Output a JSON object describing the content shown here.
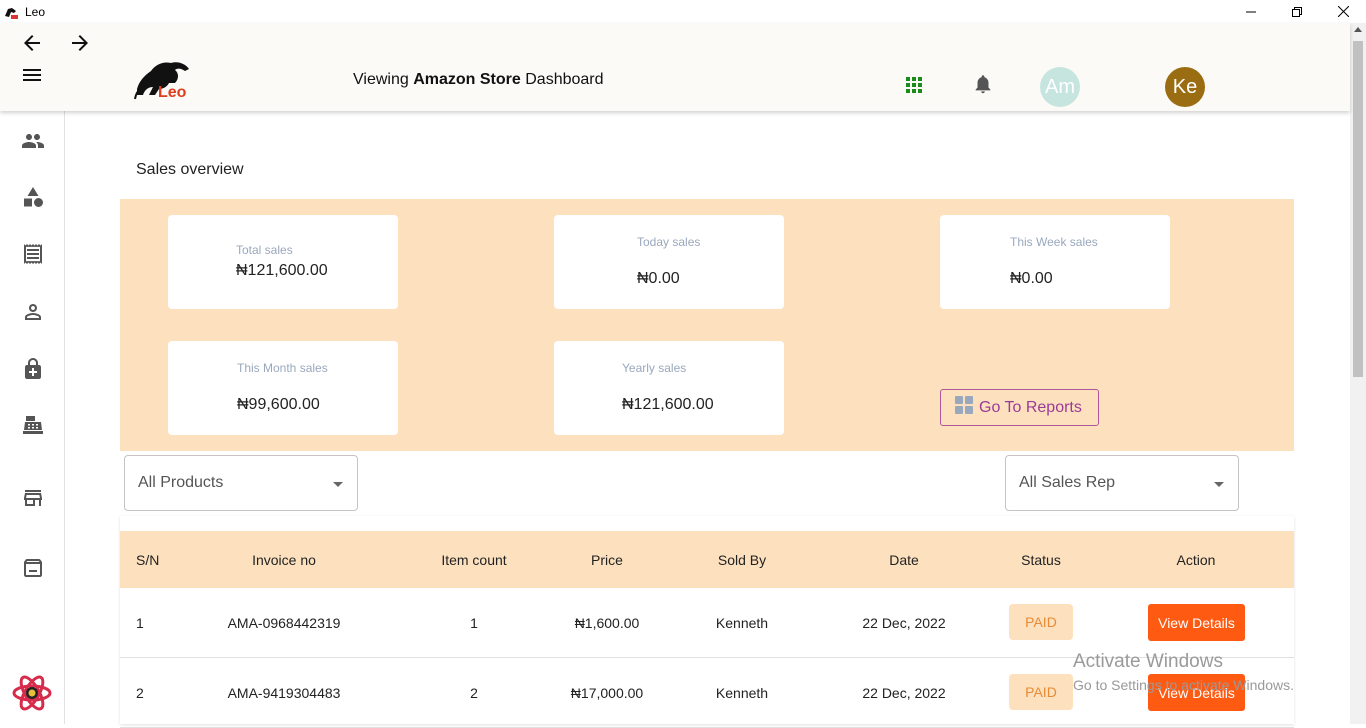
{
  "window": {
    "title": "Leo"
  },
  "header": {
    "viewing_prefix": "Viewing",
    "store_name": "Amazon Store",
    "viewing_suffix": "Dashboard",
    "logo_text": "Leo",
    "avatar_store": "Am",
    "avatar_user": "Ke",
    "colors": {
      "avatar_store_bg": "#c6e5df",
      "avatar_user_bg": "#9b6d12",
      "apps_icon": "#1a8c1a"
    }
  },
  "sidebar": {
    "icons": [
      "people-icon",
      "category-icon",
      "receipt-icon",
      "person-icon",
      "lock-plus-icon",
      "cash-register-icon",
      "store-icon",
      "archive-icon",
      "react-logo-icon"
    ]
  },
  "overview": {
    "title": "Sales overview",
    "cards": [
      {
        "label": "Total sales",
        "value": "₦121,600.00"
      },
      {
        "label": "Today sales",
        "value": "₦0.00"
      },
      {
        "label": "This Week sales",
        "value": "₦0.00"
      },
      {
        "label": "This Month sales",
        "value": "₦99,600.00"
      },
      {
        "label": "Yearly sales",
        "value": "₦121,600.00"
      }
    ],
    "reports_button": "Go To Reports",
    "colors": {
      "panel_bg": "#fde1bf",
      "label": "#9aa8bd"
    }
  },
  "filters": {
    "products": "All Products",
    "sales_rep": "All Sales Rep"
  },
  "table": {
    "headers": [
      "S/N",
      "Invoice no",
      "Item count",
      "Price",
      "Sold By",
      "Date",
      "Status",
      "Action"
    ],
    "rows": [
      {
        "sn": "1",
        "invoice": "AMA-0968442319",
        "count": "1",
        "price": "₦1,600.00",
        "sold_by": "Kenneth",
        "date": "22 Dec, 2022",
        "status": "PAID",
        "action": "View Details"
      },
      {
        "sn": "2",
        "invoice": "AMA-9419304483",
        "count": "2",
        "price": "₦17,000.00",
        "sold_by": "Kenneth",
        "date": "22 Dec, 2022",
        "status": "PAID",
        "action": "View Details"
      }
    ],
    "colors": {
      "action_button": "#ff5a12",
      "status_text": "#e88a33"
    }
  },
  "watermark": {
    "line1": "Activate Windows",
    "line2": "Go to Settings to activate Windows."
  }
}
